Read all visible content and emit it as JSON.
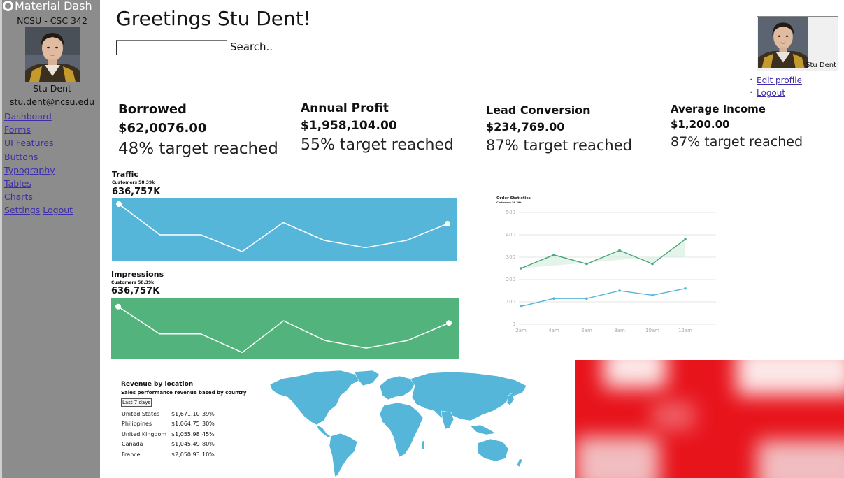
{
  "sidebar": {
    "brand": "Material Dash",
    "course": "NCSU - CSC 342",
    "name": "Stu Dent",
    "email": "stu.dent@ncsu.edu",
    "nav": [
      "Dashboard",
      "Forms",
      "UI Features",
      "Buttons",
      "Typography",
      "Tables",
      "Charts"
    ],
    "settings": "Settings",
    "logout": "Logout"
  },
  "header": {
    "greeting": "Greetings Stu Dent!",
    "search_label": "Search.."
  },
  "profile": {
    "name": "Stu Dent",
    "menu": [
      "Edit profile",
      "Logout"
    ]
  },
  "stats": [
    {
      "title": "Borrowed",
      "amount": "$62,0076.00",
      "target": "48% target reached"
    },
    {
      "title": "Annual Profit",
      "amount": "$1,958,104.00",
      "target": "55% target reached"
    },
    {
      "title": "Lead Conversion",
      "amount": "$234,769.00",
      "target": "87% target reached"
    },
    {
      "title": "Average Income",
      "amount": "$1,200.00",
      "target": "87% target reached"
    }
  ],
  "traffic": {
    "title": "Traffic",
    "subtitle": "Customers 58.39k",
    "value": "636,757K",
    "color": "#55b6da"
  },
  "impressions": {
    "title": "Impressions",
    "subtitle": "Customers 58.39k",
    "value": "636,757K",
    "color": "#52b37c"
  },
  "order_stats": {
    "title": "Order Statistics",
    "subtitle": "Customers 58.39k"
  },
  "revenue": {
    "title": "Revenue by location",
    "subtitle": "Sales performance revenue based by country",
    "filter": "Last 7 days",
    "rows": [
      {
        "country": "United States",
        "amount": "$1,671.10",
        "pct": "39%"
      },
      {
        "country": "Philippines",
        "amount": "$1,064.75",
        "pct": "30%"
      },
      {
        "country": "United Kingdom",
        "amount": "$1,055.98",
        "pct": "45%"
      },
      {
        "country": "Canada",
        "amount": "$1,045.49",
        "pct": "80%"
      },
      {
        "country": "France",
        "amount": "$2,050.93",
        "pct": "10%"
      }
    ]
  },
  "chart_data": [
    {
      "type": "line",
      "name": "traffic-sparkline",
      "x": [
        0,
        1,
        2,
        3,
        4,
        5,
        6,
        7,
        8
      ],
      "values": [
        95,
        40,
        40,
        10,
        62,
        30,
        17,
        30,
        60
      ],
      "ylim": [
        0,
        100
      ],
      "color": "#55b6da"
    },
    {
      "type": "line",
      "name": "impressions-sparkline",
      "x": [
        0,
        1,
        2,
        3,
        4,
        5,
        6,
        7,
        8
      ],
      "values": [
        90,
        40,
        40,
        6,
        64,
        28,
        14,
        28,
        60
      ],
      "ylim": [
        0,
        100
      ],
      "color": "#52b37c"
    },
    {
      "type": "line",
      "title": "Order Statistics",
      "categories": [
        "2am",
        "4am",
        "6am",
        "8am",
        "10am",
        "12am"
      ],
      "yticks": [
        0,
        100,
        200,
        300,
        400,
        500
      ],
      "ylim": [
        0,
        500
      ],
      "x": [
        0,
        1,
        2,
        3,
        4,
        5,
        6
      ],
      "series": [
        {
          "values": [
            250,
            310,
            270,
            330,
            270,
            380
          ],
          "color": "#4aa77a"
        },
        {
          "values": [
            80,
            115,
            115,
            150,
            130,
            160
          ],
          "color": "#55b6da"
        }
      ],
      "grid": true
    }
  ]
}
